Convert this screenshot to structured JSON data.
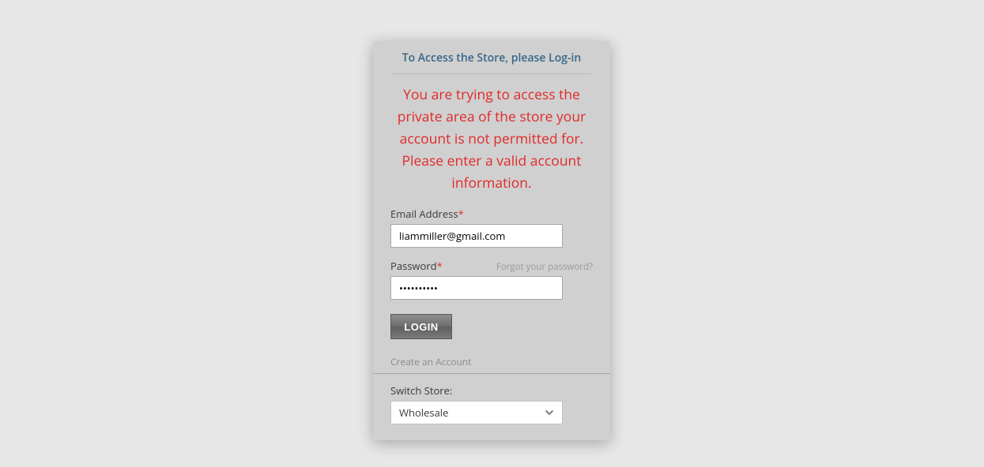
{
  "title": "To Access the Store, please Log-in",
  "error_message": "You are trying to access the private area of the store your account is not permitted for. Please enter a valid account information.",
  "fields": {
    "email": {
      "label": "Email Address",
      "required_marker": "*",
      "value": "liammiller@gmail.com"
    },
    "password": {
      "label": "Password",
      "required_marker": "*",
      "value": "••••••••••",
      "forgot_text": "Forgot your password?"
    }
  },
  "login_button": "LOGIN",
  "create_account": "Create an Account",
  "switch_store": {
    "label": "Switch Store:",
    "selected": "Wholesale"
  }
}
